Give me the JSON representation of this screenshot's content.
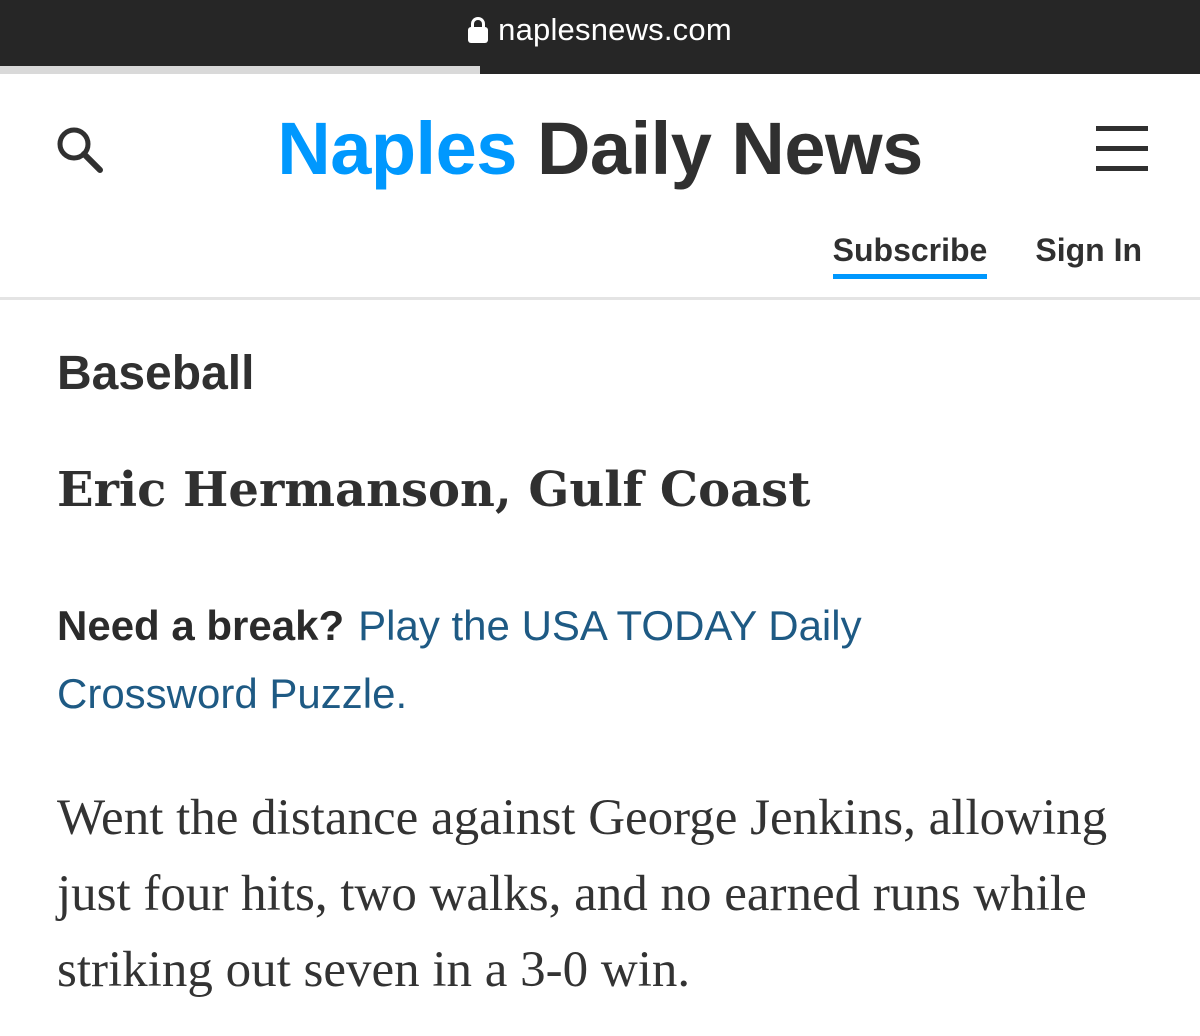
{
  "browser": {
    "url": "naplesnews.com",
    "lock_icon": "lock-icon",
    "load_progress": 0.4
  },
  "header": {
    "search_icon": "search-icon",
    "masthead_part1": "Naples",
    "masthead_part2": "Daily News",
    "menu_icon": "hamburger-menu-icon",
    "subscribe_label": "Subscribe",
    "signin_label": "Sign In"
  },
  "colors": {
    "brand_blue": "#0098fe",
    "link_blue": "#1e5a84",
    "dark_text": "#303030",
    "browser_bar": "#262626"
  },
  "article": {
    "section": "Baseball",
    "athlete": "Eric Hermanson, Gulf Coast",
    "promo_lead": "Need a break?",
    "promo_link": "Play the USA TODAY Daily Crossword Puzzle.",
    "body": "Went the distance against George Jenkins, allowing just four hits, two walks, and no earned runs while striking out seven in a 3-0 win."
  }
}
